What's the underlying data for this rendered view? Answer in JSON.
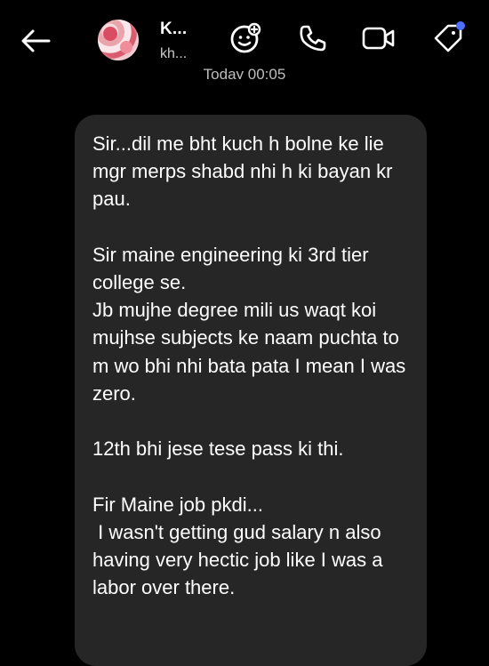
{
  "header": {
    "contact_name": "K...",
    "contact_subtitle": "kh...",
    "back_icon": "arrow-left-icon",
    "effects_icon": "sparkles-face-icon",
    "call_icon": "phone-icon",
    "video_icon": "video-camera-icon",
    "tag_icon": "tag-icon",
    "notification_dot_color": "#4c6fff"
  },
  "timestamp": "Today 00:05",
  "message": {
    "text": "Sir...dil me bht kuch h bolne ke lie mgr merps shabd nhi h ki bayan kr pau.\n\nSir maine engineering ki 3rd tier college se.\nJb mujhe degree mili us waqt koi mujhse subjects ke naam puchta to m wo bhi nhi bata pata I mean I was zero.\n\n12th bhi jese tese pass ki thi.\n\nFir Maine job pkdi...\n I wasn't getting gud salary n also having very hectic job like I was a labor over there."
  },
  "colors": {
    "background": "#000000",
    "bubble": "#262626",
    "text": "#ffffff",
    "subtext": "#c9c9c9"
  }
}
